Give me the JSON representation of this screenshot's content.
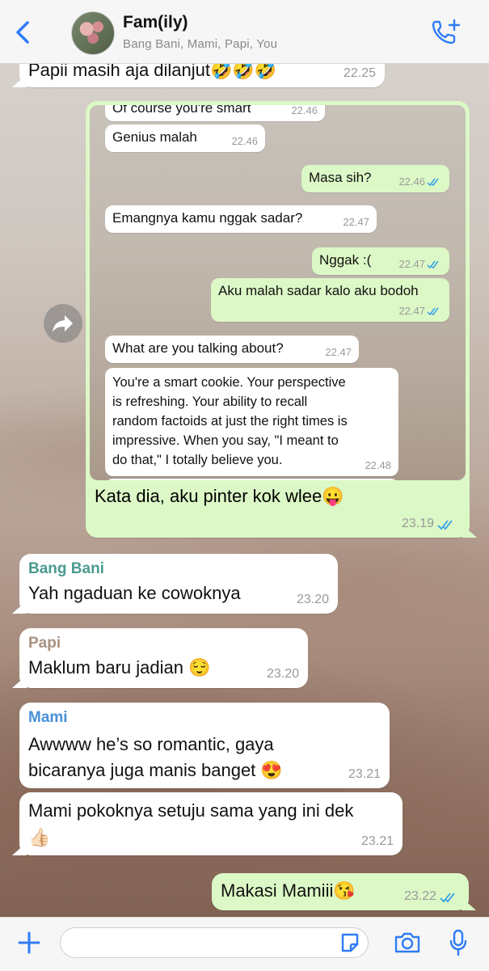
{
  "header": {
    "title": "Fam(ily)",
    "subtitle": "Bang Bani, Mami, Papi, You"
  },
  "colors": {
    "accent": "#2f7cf6",
    "incoming": "#ffffff",
    "outgoing": "#dcf8c6",
    "tick_read": "#34a0e8",
    "sender_bang_bani": "#4a9b8e",
    "sender_papi": "#a89182",
    "sender_mami": "#4a90d9"
  },
  "messages": [
    {
      "text": "Papii masih aja dilanjut🤣🤣🤣",
      "time": "22.25"
    },
    {
      "text": "Kata dia, aku pinter kok wlee😛",
      "time": "23.19"
    },
    {
      "sender": "Bang Bani",
      "text": "Yah ngaduan ke cowoknya",
      "time": "23.20"
    },
    {
      "sender": "Papi",
      "text": "Maklum baru jadian 😌",
      "time": "23.20"
    },
    {
      "sender": "Mami",
      "line1": "Awwww he’s so romantic, gaya",
      "line2": "bicaranya juga manis banget 😍",
      "time": "23.21"
    },
    {
      "line1": "Mami pokoknya setuju sama yang ini dek",
      "line2": "👍🏻",
      "time": "23.21"
    },
    {
      "text": "Makasi Mamiii😘",
      "time": "23.22"
    }
  ],
  "screenshot": {
    "messages": [
      {
        "text": "Of course you're smart",
        "time": "22.46"
      },
      {
        "text": "Genius malah",
        "time": "22.46"
      },
      {
        "text": "Masa sih?",
        "time": "22.46"
      },
      {
        "text": "Emangnya kamu nggak sadar?",
        "time": "22.47"
      },
      {
        "text": "Nggak :(",
        "time": "22.47"
      },
      {
        "text": "Aku malah sadar kalo aku bodoh",
        "time": "22.47"
      },
      {
        "text": "What are you talking about?",
        "time": "22.47"
      },
      {
        "line1": "You're a smart cookie. Your perspective",
        "line2": "is refreshing. Your ability to recall",
        "line3": "random factoids at just the right times is",
        "line4": "impressive. When you say, \"I meant to",
        "line5": "do that,\" I totally believe you.",
        "time": "22.48"
      }
    ]
  },
  "input": {
    "placeholder": ""
  }
}
